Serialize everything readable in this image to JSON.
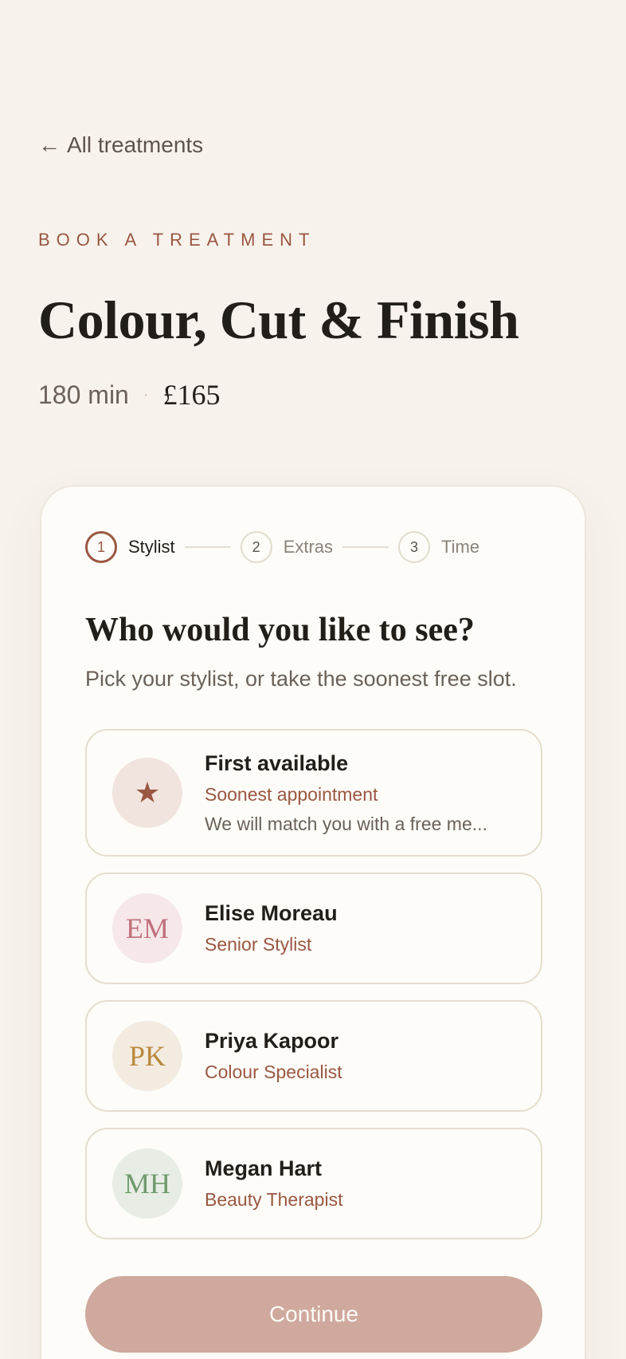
{
  "nav": {
    "back_arrow": "←",
    "back_label": "All treatments"
  },
  "header": {
    "eyebrow": "Book a treatment",
    "title": "Colour, Cut & Finish",
    "duration": "180 min",
    "separator": "·",
    "price": "£165"
  },
  "stepper": {
    "steps": [
      {
        "number": "1",
        "label": "Stylist",
        "state": "active"
      },
      {
        "number": "2",
        "label": "Extras",
        "state": "upcoming"
      },
      {
        "number": "3",
        "label": "Time",
        "state": "upcoming"
      }
    ]
  },
  "selection": {
    "heading": "Who would you like to see?",
    "subheading": "Pick your stylist, or take the soonest free slot.",
    "options": [
      {
        "avatar": "★",
        "name": "First available",
        "role": "Soonest appointment",
        "description": "We will match you with a free me...",
        "avatar_bg": "#f1e3de",
        "avatar_color": "#9a5742",
        "icon": "star-icon"
      },
      {
        "avatar": "EM",
        "name": "Elise Moreau",
        "role": "Senior Stylist",
        "avatar_bg": "#f6e7e9",
        "avatar_color": "#c0707c"
      },
      {
        "avatar": "PK",
        "name": "Priya Kapoor",
        "role": "Colour Specialist",
        "avatar_bg": "#f3ebe0",
        "avatar_color": "#b8893e"
      },
      {
        "avatar": "MH",
        "name": "Megan Hart",
        "role": "Beauty Therapist",
        "avatar_bg": "#e7ede5",
        "avatar_color": "#6f9a6c"
      }
    ]
  },
  "actions": {
    "continue_label": "Continue",
    "continue_state": "disabled"
  },
  "colors": {
    "accent": "#9a5742",
    "background": "#f7f2ec",
    "card": "#fdfcf8",
    "button_disabled": "#cfa99d"
  }
}
